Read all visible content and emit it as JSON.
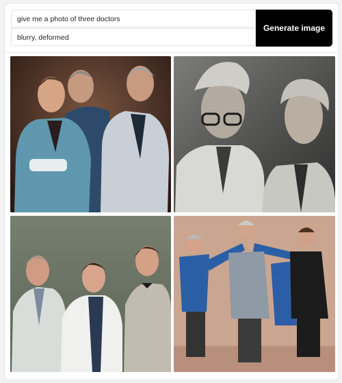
{
  "prompt": {
    "positive_value": "give me a photo of three doctors",
    "negative_value": "blurry, deformed"
  },
  "generate_button": {
    "label": "Generate image"
  },
  "results": [
    {
      "id": "image-1"
    },
    {
      "id": "image-2"
    },
    {
      "id": "image-3"
    },
    {
      "id": "image-4"
    }
  ]
}
